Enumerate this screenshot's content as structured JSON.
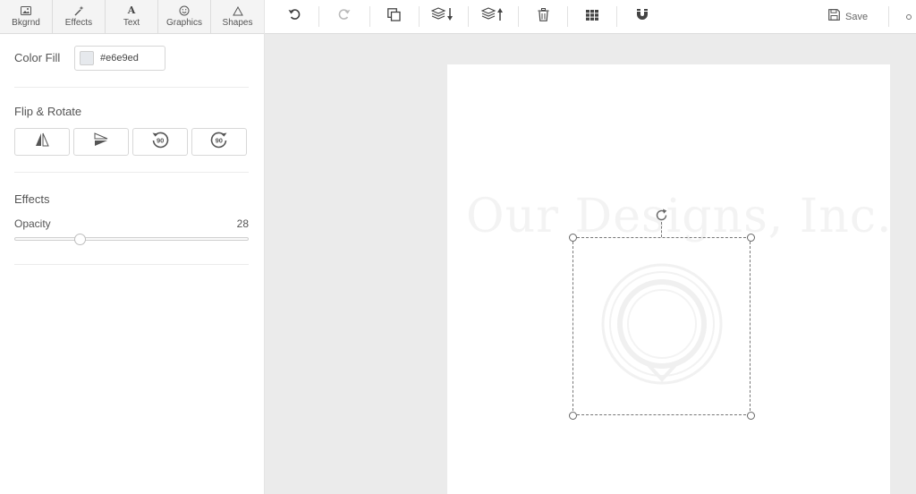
{
  "tabs": [
    {
      "label": "Bkgrnd",
      "icon": "image-icon"
    },
    {
      "label": "Effects",
      "icon": "magic-wand-icon"
    },
    {
      "label": "Text",
      "icon": "text-a-icon",
      "glyph": "A"
    },
    {
      "label": "Graphics",
      "icon": "smiley-icon"
    },
    {
      "label": "Shapes",
      "icon": "triangle-icon"
    }
  ],
  "panel": {
    "color_fill_label": "Color Fill",
    "color_fill_value": "#e6e9ed",
    "flip_rotate_title": "Flip & Rotate",
    "flip_buttons": [
      {
        "icon": "flip-horizontal-icon"
      },
      {
        "icon": "flip-vertical-icon"
      },
      {
        "icon": "rotate-left-90-icon",
        "label": "90"
      },
      {
        "icon": "rotate-right-90-icon",
        "label": "90"
      }
    ],
    "effects_title": "Effects",
    "opacity_label": "Opacity",
    "opacity_value": "28",
    "opacity_fraction": 0.28
  },
  "toolbar": {
    "save_label": "Save",
    "icons": [
      "undo-icon",
      "redo-icon",
      "duplicate-icon",
      "send-backward-icon",
      "bring-forward-icon",
      "trash-icon",
      "grid-icon",
      "magnet-icon",
      "save-icon"
    ]
  },
  "canvas": {
    "watermark_text": "Our Designs, Inc."
  },
  "colors": {
    "fill": "#e6e9ed",
    "workspace": "#ebebeb",
    "page": "#ffffff"
  }
}
